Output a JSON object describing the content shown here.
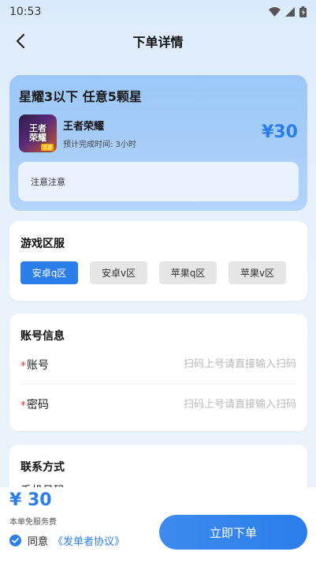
{
  "status_bar": {
    "time": "10:53"
  },
  "nav": {
    "title": "下单详情"
  },
  "hero": {
    "title": "星耀3以下 任意5颗星",
    "game_logo_text": "王者\n荣耀",
    "game_logo_tag": "手游",
    "game_name": "王者荣耀",
    "estimated_time": "预计完成时间: 3小时",
    "price": "¥30",
    "notice": "注意注意"
  },
  "region": {
    "title": "游戏区服",
    "options": [
      "安卓q区",
      "安卓v区",
      "苹果q区",
      "苹果v区"
    ],
    "selected": "安卓q区"
  },
  "account": {
    "title": "账号信息",
    "account_label": "账号",
    "account_placeholder": "扫码上号请直接输入扫码",
    "password_label": "密码",
    "password_placeholder": "扫码上号请直接输入扫码",
    "required_mark": "*"
  },
  "contact": {
    "title": "联系方式",
    "phone_label": "手机号码"
  },
  "bottom": {
    "total_price": "¥ 30",
    "fee_note": "本单免服务费",
    "agree_text": "同意",
    "agreement_link": "《发单者协议》",
    "submit_label": "立即下单"
  },
  "colors": {
    "accent": "#2b7de9",
    "required": "#e53935"
  }
}
